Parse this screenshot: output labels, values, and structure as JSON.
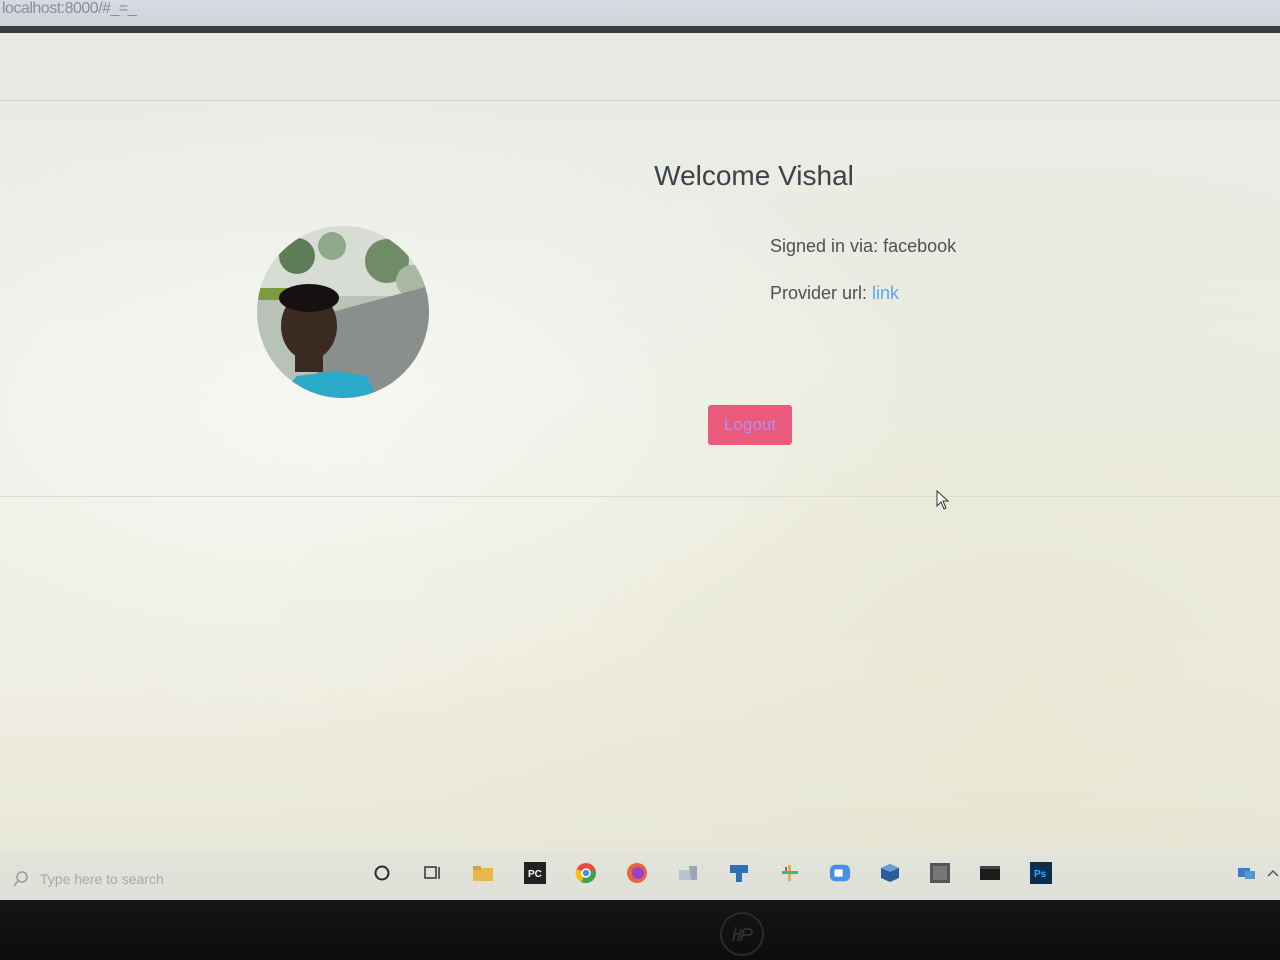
{
  "browser": {
    "url": "localhost:8000/#_=_"
  },
  "page": {
    "title": "Welcome Vishal",
    "signed_in_label": "Signed in via: facebook",
    "provider_label": "Provider url: ",
    "provider_link": "link",
    "logout_label": "Logout"
  },
  "avatar": {
    "description_icon": "user-photo"
  },
  "taskbar": {
    "search_placeholder": "Type here to search",
    "icons": [
      "cortana-icon",
      "task-view-icon",
      "file-explorer-icon",
      "pycharm-icon",
      "chrome-icon",
      "firefox-icon",
      "app-icon",
      "postman-icon",
      "slack-icon",
      "zoom-icon",
      "virtualbox-icon",
      "app-window-icon",
      "terminal-icon",
      "photoshop-icon"
    ],
    "pycharm_text": "PC",
    "photoshop_text": "Ps"
  },
  "colors": {
    "logout_bg": "#ea5a7b",
    "link": "#5ba8e8",
    "title": "#3d4148"
  }
}
